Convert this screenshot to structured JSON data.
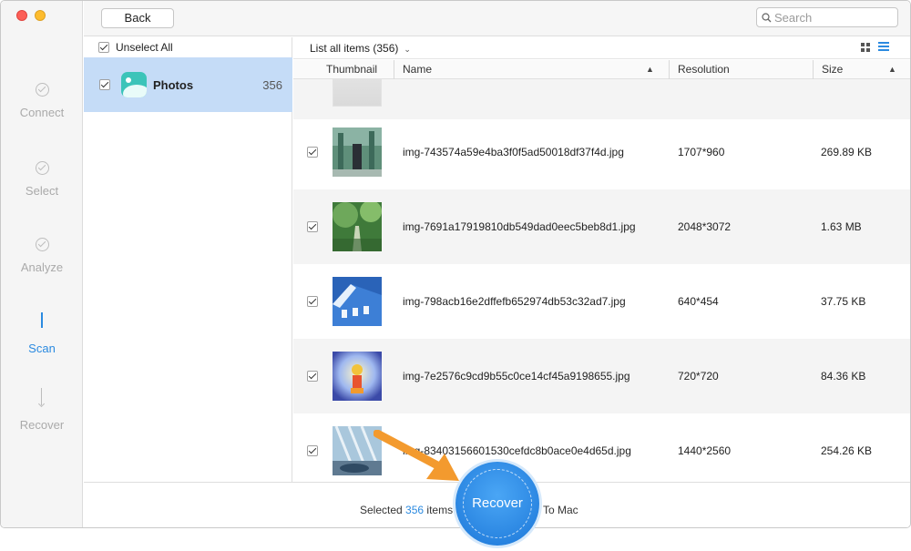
{
  "steps": [
    {
      "label": "Connect",
      "state": "done"
    },
    {
      "label": "Select",
      "state": "done"
    },
    {
      "label": "Analyze",
      "state": "done"
    },
    {
      "label": "Scan",
      "state": "active"
    },
    {
      "label": "Recover",
      "state": "pending"
    }
  ],
  "toolbar": {
    "back_label": "Back",
    "search_placeholder": "Search"
  },
  "sidebar": {
    "unselect_all_label": "Unselect All",
    "category": {
      "name": "Photos",
      "count": "356"
    }
  },
  "list": {
    "list_all_label": "List all items (356)",
    "columns": {
      "thumbnail": "Thumbnail",
      "name": "Name",
      "resolution": "Resolution",
      "size": "Size"
    },
    "rows": [
      {
        "name": "img-743574a59e4ba3f0f5ad50018df37f4d.jpg",
        "resolution": "1707*960",
        "size": "269.89 KB"
      },
      {
        "name": "img-7691a17919810db549dad0eec5beb8d1.jpg",
        "resolution": "2048*3072",
        "size": "1.63 MB"
      },
      {
        "name": "img-798acb16e2dffefb652974db53c32ad7.jpg",
        "resolution": "640*454",
        "size": "37.75 KB"
      },
      {
        "name": "img-7e2576c9cd9b55c0ce14cf45a9198655.jpg",
        "resolution": "720*720",
        "size": "84.36 KB"
      },
      {
        "name": "img-83403156601530cefdc8b0ace0e4d65d.jpg",
        "resolution": "1440*2560",
        "size": "254.26 KB"
      }
    ]
  },
  "footer": {
    "selected_prefix": "Selected",
    "selected_count": "356",
    "selected_suffix": "items",
    "recover_label": "Recover",
    "to_mac_label": "To Mac"
  },
  "colors": {
    "accent": "#2b8ae0",
    "selection": "#c5dcf7",
    "pointer_arrow": "#f39a2e"
  }
}
